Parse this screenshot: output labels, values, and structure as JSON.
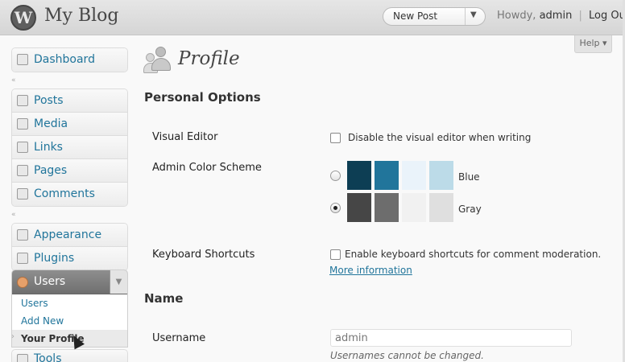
{
  "header": {
    "logo_letter": "W",
    "site_title": "My Blog",
    "new_post_label": "New Post",
    "new_post_arrow": "▼",
    "howdy_prefix": "Howdy,",
    "username": "admin",
    "separator": "|",
    "logout_label": "Log Out",
    "help_label": "Help ▾"
  },
  "sidebar": {
    "group1": [
      {
        "label": "Dashboard",
        "icon": "home-icon"
      }
    ],
    "collapse_glyph": "«",
    "group2": [
      {
        "label": "Posts",
        "icon": "pin-icon"
      },
      {
        "label": "Media",
        "icon": "media-icon"
      },
      {
        "label": "Links",
        "icon": "link-icon"
      },
      {
        "label": "Pages",
        "icon": "pages-icon"
      },
      {
        "label": "Comments",
        "icon": "comment-icon"
      }
    ],
    "group3": [
      {
        "label": "Appearance",
        "icon": "appearance-icon"
      },
      {
        "label": "Plugins",
        "icon": "plugin-icon"
      }
    ],
    "users": {
      "label": "Users",
      "toggle": "▼",
      "submenu": [
        "Users",
        "Add New",
        "Your Profile"
      ]
    },
    "tools_label": "Tools"
  },
  "main": {
    "page_title": "Profile",
    "personal_options_title": "Personal Options",
    "visual_editor": {
      "label": "Visual Editor",
      "checkbox_text": "Disable the visual editor when writing",
      "checked": false
    },
    "color_scheme": {
      "label": "Admin Color Scheme",
      "options": [
        {
          "name": "Blue",
          "colors": [
            "#0d3e54",
            "#21759b",
            "#eaf3fa",
            "#bcdbe8"
          ],
          "selected": false
        },
        {
          "name": "Gray",
          "colors": [
            "#464646",
            "#6d6d6d",
            "#f1f1f1",
            "#dfdfdf"
          ],
          "selected": true
        }
      ]
    },
    "keyboard_shortcuts": {
      "label": "Keyboard Shortcuts",
      "checkbox_text": "Enable keyboard shortcuts for comment moderation.",
      "more_info": "More information",
      "checked": false
    },
    "name_title": "Name",
    "username_field": {
      "label": "Username",
      "value": "admin",
      "note": "Usernames cannot be changed."
    }
  }
}
